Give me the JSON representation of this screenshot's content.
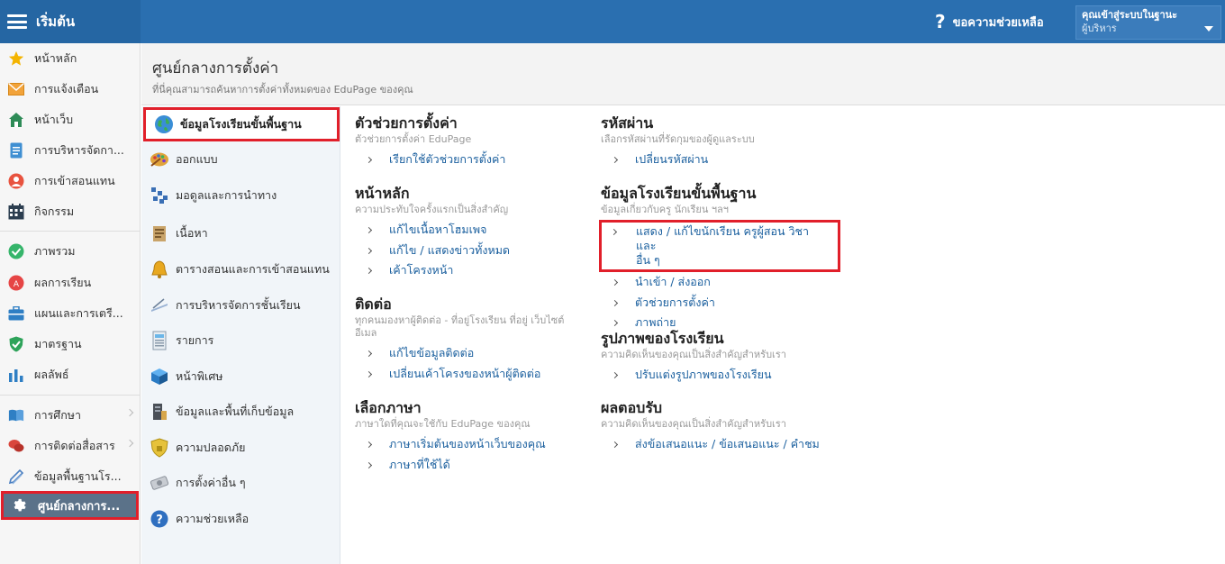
{
  "topbar": {
    "brand_label": "เริ่มต้น",
    "help_label": "ขอความช่วยเหลือ",
    "login_line1": "คุณเข้าสู่ระบบในฐานะ",
    "login_line2": "ผู้บริหาร"
  },
  "leftnav": {
    "items": [
      {
        "label": "หน้าหลัก",
        "icon": "star-icon"
      },
      {
        "label": "การแจ้งเตือน",
        "icon": "envelope-icon"
      },
      {
        "label": "หน้าเว็บ",
        "icon": "home-icon"
      },
      {
        "label": "การบริหารจัดกา...",
        "icon": "document-icon"
      },
      {
        "label": "การเข้าสอนแทน",
        "icon": "person-icon"
      },
      {
        "label": "กิจกรรม",
        "icon": "calendar-icon"
      },
      {
        "label": "ภาพรวม",
        "icon": "check-circle-icon"
      },
      {
        "label": "ผลการเรียน",
        "icon": "grade-icon"
      },
      {
        "label": "แผนและการเตรี...",
        "icon": "briefcase-icon"
      },
      {
        "label": "มาตรฐาน",
        "icon": "shield-check-icon"
      },
      {
        "label": "ผลลัพธ์",
        "icon": "bar-chart-icon"
      },
      {
        "label": "การศึกษา",
        "icon": "book-icon"
      },
      {
        "label": "การติดต่อสื่อสาร",
        "icon": "chat-icon"
      },
      {
        "label": "ข้อมูลพื้นฐานโร...",
        "icon": "pencil-icon"
      },
      {
        "label": "ศูนย์กลางการ...",
        "icon": "gear-icon"
      }
    ]
  },
  "header": {
    "title": "ศูนย์กลางการตั้งค่า",
    "subtitle": "ที่นี่คุณสามารถค้นหาการตั้งค่าทั้งหมดของ EduPage ของคุณ"
  },
  "categories": [
    {
      "label": "ข้อมูลโรงเรียนขั้นพื้นฐาน",
      "icon": "globe-icon"
    },
    {
      "label": "ออกแบบ",
      "icon": "palette-icon"
    },
    {
      "label": "มอดูลและการนำทาง",
      "icon": "modules-icon"
    },
    {
      "label": "เนื้อหา",
      "icon": "content-icon"
    },
    {
      "label": "ตารางสอนและการเข้าสอนแทน",
      "icon": "bell-icon"
    },
    {
      "label": "การบริหารจัดการชั้นเรียน",
      "icon": "class-icon"
    },
    {
      "label": "รายการ",
      "icon": "list-icon"
    },
    {
      "label": "หน้าพิเศษ",
      "icon": "cube-icon"
    },
    {
      "label": "ข้อมูลและพื้นที่เก็บข้อมูล",
      "icon": "storage-icon"
    },
    {
      "label": "ความปลอดภัย",
      "icon": "security-shield-icon"
    },
    {
      "label": "การตั้งค่าอื่น ๆ",
      "icon": "other-settings-icon"
    },
    {
      "label": "ความช่วยเหลือ",
      "icon": "help-icon"
    }
  ],
  "sections": {
    "wizard": {
      "title": "ตัวช่วยการตั้งค่า",
      "desc": "ตัวช่วยการตั้งค่า EduPage",
      "links": [
        "เรียกใช้ตัวช่วยการตั้งค่า"
      ]
    },
    "home": {
      "title": "หน้าหลัก",
      "desc": "ความประทับใจครั้งแรกเป็นสิ่งสำคัญ",
      "links": [
        "แก้ไขเนื้อหาโฮมเพจ",
        "แก้ไข / แสดงข่าวทั้งหมด",
        "เค้าโครงหน้า"
      ]
    },
    "contact": {
      "title": "ติดต่อ",
      "desc_line1": "ทุกคนมองหาผู้ติดต่อ - ที่อยู่โรงเรียน ที่อยู่ เว็บไซต์",
      "desc_line2": "อีเมล",
      "links": [
        "แก้ไขข้อมูลติดต่อ",
        "เปลี่ยนเค้าโครงของหน้าผู้ติดต่อ"
      ]
    },
    "language": {
      "title": "เลือกภาษา",
      "desc": "ภาษาใดที่คุณจะใช้กับ EduPage ของคุณ",
      "links": [
        "ภาษาเริ่มต้นของหน้าเว็บของคุณ",
        "ภาษาที่ใช้ได้"
      ]
    },
    "password": {
      "title": "รหัสผ่าน",
      "desc": "เลือกรหัสผ่านที่รัดกุมของผู้ดูแลระบบ",
      "links": [
        "เปลี่ยนรหัสผ่าน"
      ]
    },
    "school_info": {
      "title": "ข้อมูลโรงเรียนขั้นพื้นฐาน",
      "desc": "ข้อมูลเกี่ยวกับครู นักเรียน ฯลฯ",
      "highlight_line1": "แสดง / แก้ไขนักเรียน ครูผู้สอน วิชา และ",
      "highlight_line2": "อื่น ๆ",
      "links": [
        "นำเข้า / ส่งออก",
        "ตัวช่วยการตั้งค่า",
        "ภาพถ่าย"
      ]
    },
    "school_image": {
      "title": "รูปภาพของโรงเรียน",
      "desc": "ความคิดเห็นของคุณเป็นสิ่งสำคัญสำหรับเรา",
      "links": [
        "ปรับแต่งรูปภาพของโรงเรียน"
      ]
    },
    "feedback": {
      "title": "ผลตอบรับ",
      "desc": "ความคิดเห็นของคุณเป็นสิ่งสำคัญสำหรับเรา",
      "links": [
        "ส่งข้อเสนอแนะ / ข้อเสนอแนะ / คำชม"
      ]
    }
  }
}
